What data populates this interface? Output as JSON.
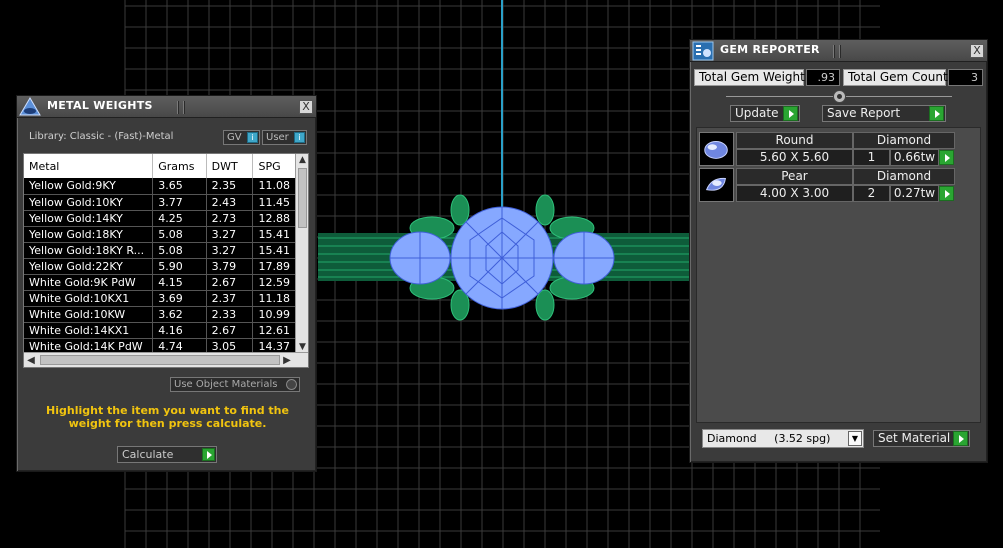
{
  "metal_weights": {
    "title": "METAL WEIGHTS",
    "library_label": "Library: Classic - (Fast)-Metal",
    "toggle_gv": "GV",
    "toggle_user": "User",
    "toggle_indicator": "i",
    "columns": [
      "Metal",
      "Grams",
      "DWT",
      "SPG"
    ],
    "rows": [
      [
        "Yellow Gold:9KY",
        "3.65",
        "2.35",
        "11.08"
      ],
      [
        "Yellow Gold:10KY",
        "3.77",
        "2.43",
        "11.45"
      ],
      [
        "Yellow Gold:14KY",
        "4.25",
        "2.73",
        "12.88"
      ],
      [
        "Yellow Gold:18KY",
        "5.08",
        "3.27",
        "15.41"
      ],
      [
        "Yellow Gold:18KY R...",
        "5.08",
        "3.27",
        "15.41"
      ],
      [
        "Yellow Gold:22KY",
        "5.90",
        "3.79",
        "17.89"
      ],
      [
        "White Gold:9K PdW",
        "4.15",
        "2.67",
        "12.59"
      ],
      [
        "White Gold:10KX1",
        "3.69",
        "2.37",
        "11.18"
      ],
      [
        "White Gold:10KW",
        "3.62",
        "2.33",
        "10.99"
      ],
      [
        "White Gold:14KX1",
        "4.16",
        "2.67",
        "12.61"
      ],
      [
        "White Gold:14K PdW",
        "4.74",
        "3.05",
        "14.37"
      ]
    ],
    "use_object_materials": "Use Object Materials",
    "hint": "Highlight the item you want to find the weight for then press calculate.",
    "calculate_label": "Calculate",
    "close_label": "X"
  },
  "gem_reporter": {
    "title": "GEM REPORTER",
    "close_label": "X",
    "total_weight_label": "Total Gem Weight",
    "total_weight_value": ".93",
    "total_count_label": "Total Gem Count",
    "total_count_value": "3",
    "update_label": "Update",
    "save_report_label": "Save Report",
    "gems": [
      {
        "shape": "Round",
        "material": "Diamond",
        "size": "5.60 X 5.60",
        "count": "1",
        "weight": "0.66tw",
        "icon": "round-gem-icon"
      },
      {
        "shape": "Pear",
        "material": "Diamond",
        "size": "4.00 X 3.00",
        "count": "2",
        "weight": "0.27tw",
        "icon": "pear-gem-icon"
      }
    ],
    "material_select_value": "Diamond     (3.52 spg)",
    "set_material_label": "Set Material"
  },
  "colors": {
    "accent_green": "#2aa532",
    "hint_yellow": "#f1c40f",
    "gem_blue": "#7fa8ff",
    "metal_green": "#1f8a5a"
  }
}
